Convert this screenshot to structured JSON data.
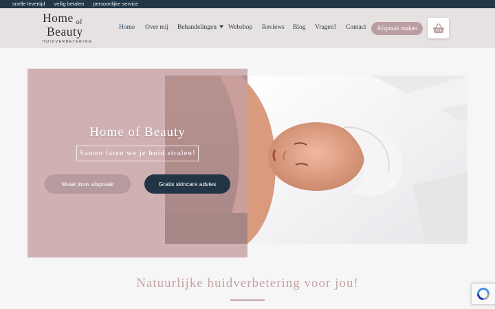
{
  "topbar": {
    "items": [
      "snelle levertijd",
      "veilig betalen",
      "persoonlijke service"
    ]
  },
  "logo": {
    "line1": "Home",
    "of": "of",
    "line2": "Beauty",
    "tagline": "HUIDVERBETERING"
  },
  "nav": {
    "items": [
      "Home",
      "Over mij",
      "Behandelingen",
      "Webshop",
      "Reviews",
      "Blog",
      "Vragen?",
      "Contact"
    ],
    "cta": "Afspraak maken"
  },
  "hero": {
    "title": "Home of Beauty",
    "subtitle": "Samen laten we je huid stralen!",
    "button_primary": "Maak jouw afspraak",
    "button_secondary": "Gratis skincare advies"
  },
  "section": {
    "title": "Natuurlijke huidverbetering voor jou!"
  },
  "colors": {
    "topbar": "#223849",
    "header": "#e6e2e2",
    "accent_pink": "#bb9ea1",
    "dark_navy": "#213546"
  },
  "icons": {
    "cart": "shopping-basket-icon",
    "recaptcha": "recaptcha-icon"
  }
}
